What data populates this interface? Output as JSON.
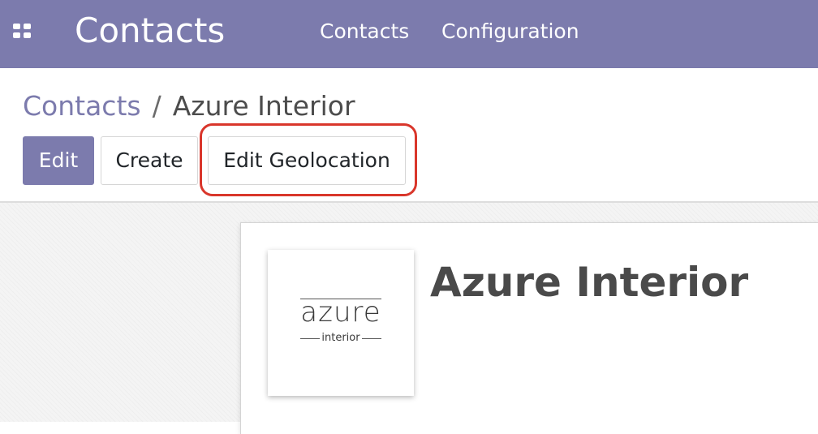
{
  "navbar": {
    "apps_icon": "apps-grid-icon",
    "app_title": "Contacts",
    "menu": [
      {
        "label": "Contacts"
      },
      {
        "label": "Configuration"
      }
    ],
    "background_color": "#7c7bad"
  },
  "breadcrumb": {
    "parent": "Contacts",
    "separator": "/",
    "current": "Azure Interior"
  },
  "toolbar": {
    "edit_label": "Edit",
    "create_label": "Create",
    "edit_geolocation_label": "Edit Geolocation",
    "highlight_color": "#d9362b"
  },
  "record": {
    "name": "Azure Interior",
    "logo": {
      "word": "azure",
      "sub": "interior"
    }
  }
}
